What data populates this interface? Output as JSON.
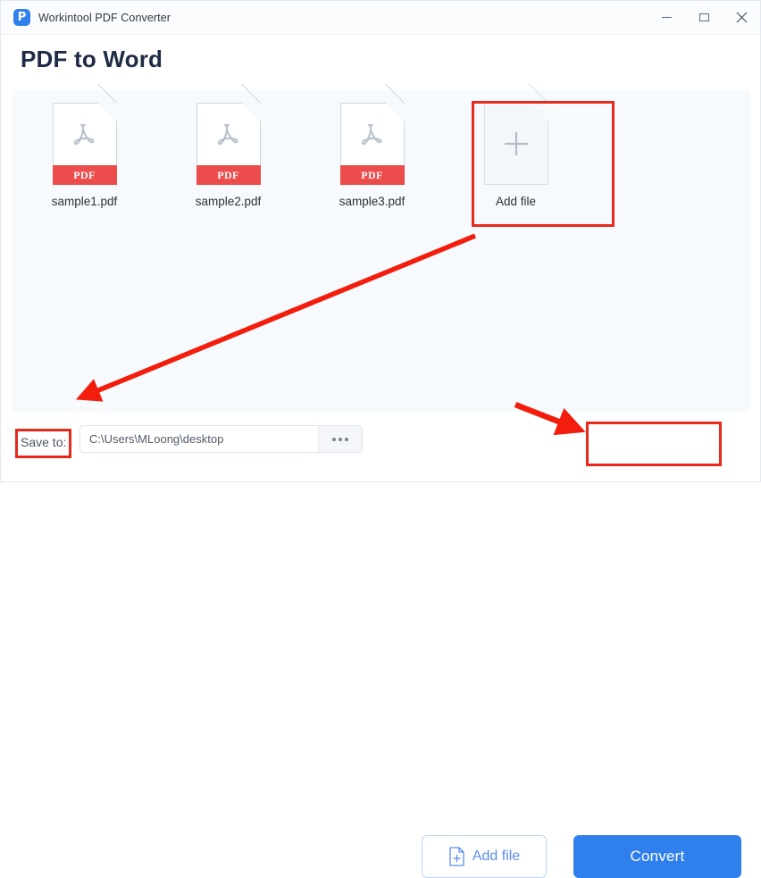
{
  "window": {
    "title": "Workintool PDF Converter",
    "logo_glyph": "P",
    "controls": [
      {
        "name": "minimize",
        "icon": "minimize-icon"
      },
      {
        "name": "maximize",
        "icon": "maximize-icon"
      },
      {
        "name": "close",
        "icon": "close-icon"
      }
    ]
  },
  "page": {
    "heading": "PDF to Word"
  },
  "files": [
    {
      "name": "sample1.pdf",
      "badge": "PDF"
    },
    {
      "name": "sample2.pdf",
      "badge": "PDF"
    },
    {
      "name": "sample3.pdf",
      "badge": "PDF"
    }
  ],
  "add_tile": {
    "label": "Add file",
    "icon": "plus-icon"
  },
  "footer": {
    "save_to_label": "Save to:",
    "save_path": "C:\\Users\\MLoong\\desktop",
    "browse_label": "...",
    "add_file_button": "Add file",
    "convert_button": "Convert"
  },
  "colors": {
    "accent_blue": "#2f80ed",
    "pdf_red": "#ed4c4c",
    "annotation_red": "#e8291c",
    "panel_bg": "#f6fafd",
    "heading": "#1f2a44"
  },
  "annotations": [
    {
      "type": "rectangle",
      "target": "add-file-tile"
    },
    {
      "type": "rectangle",
      "target": "save-to-label"
    },
    {
      "type": "rectangle",
      "target": "convert-button"
    },
    {
      "type": "arrow",
      "from": "add-file-tile",
      "to": "save-to-label"
    },
    {
      "type": "arrow",
      "from": "add-file-button",
      "to": "convert-button"
    }
  ]
}
